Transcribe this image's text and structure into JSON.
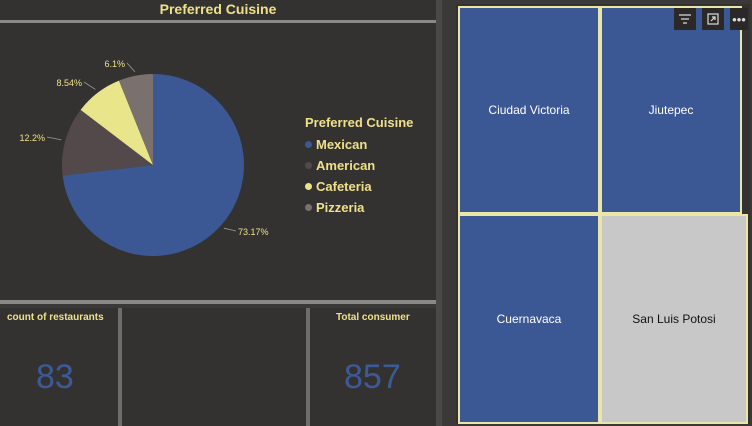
{
  "pie_chart": {
    "title": "Preferred Cuisine",
    "legend_title": "Preferred Cuisine",
    "chart_data": {
      "type": "pie",
      "title": "Preferred Cuisine",
      "categories": [
        "Mexican",
        "American",
        "Cafeteria",
        "Pizzeria"
      ],
      "values": [
        73.17,
        12.2,
        8.54,
        6.1
      ],
      "labels": [
        "73.17%",
        "12.2%",
        "8.54%",
        "6.1%"
      ],
      "colors": [
        "#3b5894",
        "#54494a",
        "#e9e58b",
        "#7a716e"
      ],
      "legend_position": "right"
    }
  },
  "kpis": {
    "count_label": "count of restaurants",
    "count_value": "83",
    "total_label": "Total consumer",
    "total_value": "857"
  },
  "treemap": {
    "tiles": [
      {
        "label": "Ciudad Victoria"
      },
      {
        "label": "Jiutepec"
      },
      {
        "label": "Cuernavaca"
      },
      {
        "label": "San Luis Potosi"
      }
    ],
    "toolbar": {
      "filter_icon": "filter-icon",
      "focus_icon": "focus-mode-icon",
      "more_icon": "more-options-icon"
    }
  }
}
